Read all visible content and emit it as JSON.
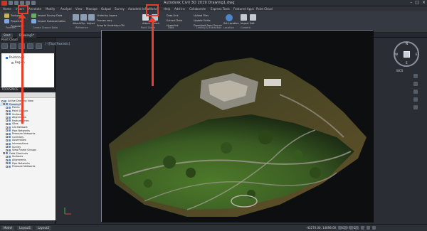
{
  "app": {
    "title": "Autodesk Civil 3D 2019   Drawing1.dwg"
  },
  "ribbon_tabs": [
    "Home",
    "Insert",
    "Annotate",
    "Modify",
    "Analyze",
    "View",
    "Manage",
    "Output",
    "Survey",
    "Autodesk InfraWorks",
    "Help",
    "Add-ins",
    "Collaborate",
    "Express Tools",
    "Featured Apps",
    "Point Cloud"
  ],
  "ribbon": {
    "groups": [
      {
        "title": "Palettes",
        "items": [
          "Toolspace",
          "Properties",
          "Prospector"
        ]
      },
      {
        "title": "Create Ground Data",
        "items": [
          "Import Survey Data",
          "Import Subassemblies"
        ]
      },
      {
        "title": "Attach",
        "items": [
          "Attach",
          "Clip",
          "Adjust"
        ]
      },
      {
        "title": "Reference",
        "items": [
          "Underlay Layers",
          "Frames vary",
          "Snap to Underlays ON"
        ]
      },
      {
        "title": "Point Cloud",
        "items": [
          "Attach",
          "Attach"
        ]
      },
      {
        "title": "Data",
        "items": [
          "Data Link",
          "Extract Data",
          "Hyperlink"
        ]
      },
      {
        "title": "Linking & Extraction",
        "items": [
          "Upload Files",
          "Update Fields",
          "Download from Source"
        ]
      },
      {
        "title": "Location",
        "items": [
          "Set Location"
        ]
      },
      {
        "title": "Content",
        "items": [
          "Import",
          "Edit"
        ]
      }
    ]
  },
  "file_tabs": [
    "Start",
    "Drawing1*"
  ],
  "left_panel": {
    "title": "Point Cloud",
    "tree": [
      "Pointcloud",
      "Region"
    ]
  },
  "prospector": {
    "title": "TOOLSPACE",
    "items": [
      "Active Drawing View",
      "Drawing1",
      "Points",
      "Point Groups",
      "Surfaces",
      "Alignments",
      "Feature Lines",
      "Sites",
      "Cat Network",
      "Pipe Networks",
      "Pressure Networks",
      "Corridors",
      "Assemblies",
      "Intersections",
      "Survey",
      "View Frame Groups",
      "Data Shortcuts",
      "Surfaces",
      "Alignments",
      "Pipe Networks",
      "Pressure Networks"
    ]
  },
  "viewport": {
    "label": "[-][Top][Realistic]"
  },
  "viewcube": {
    "top_label": "TOP",
    "north": "N",
    "south": "S",
    "east": "E",
    "west": "W",
    "wcs": "WCS"
  },
  "status": {
    "layout_tabs": [
      "Model",
      "Layout1",
      "Layout2"
    ],
    "coords": "-43270.00, 14898.00, 0.0000   MODEL"
  },
  "colors": {
    "highlight": "#e8402c",
    "ribbon_bg": "#353a42",
    "panel_bg": "#2b2f36"
  }
}
